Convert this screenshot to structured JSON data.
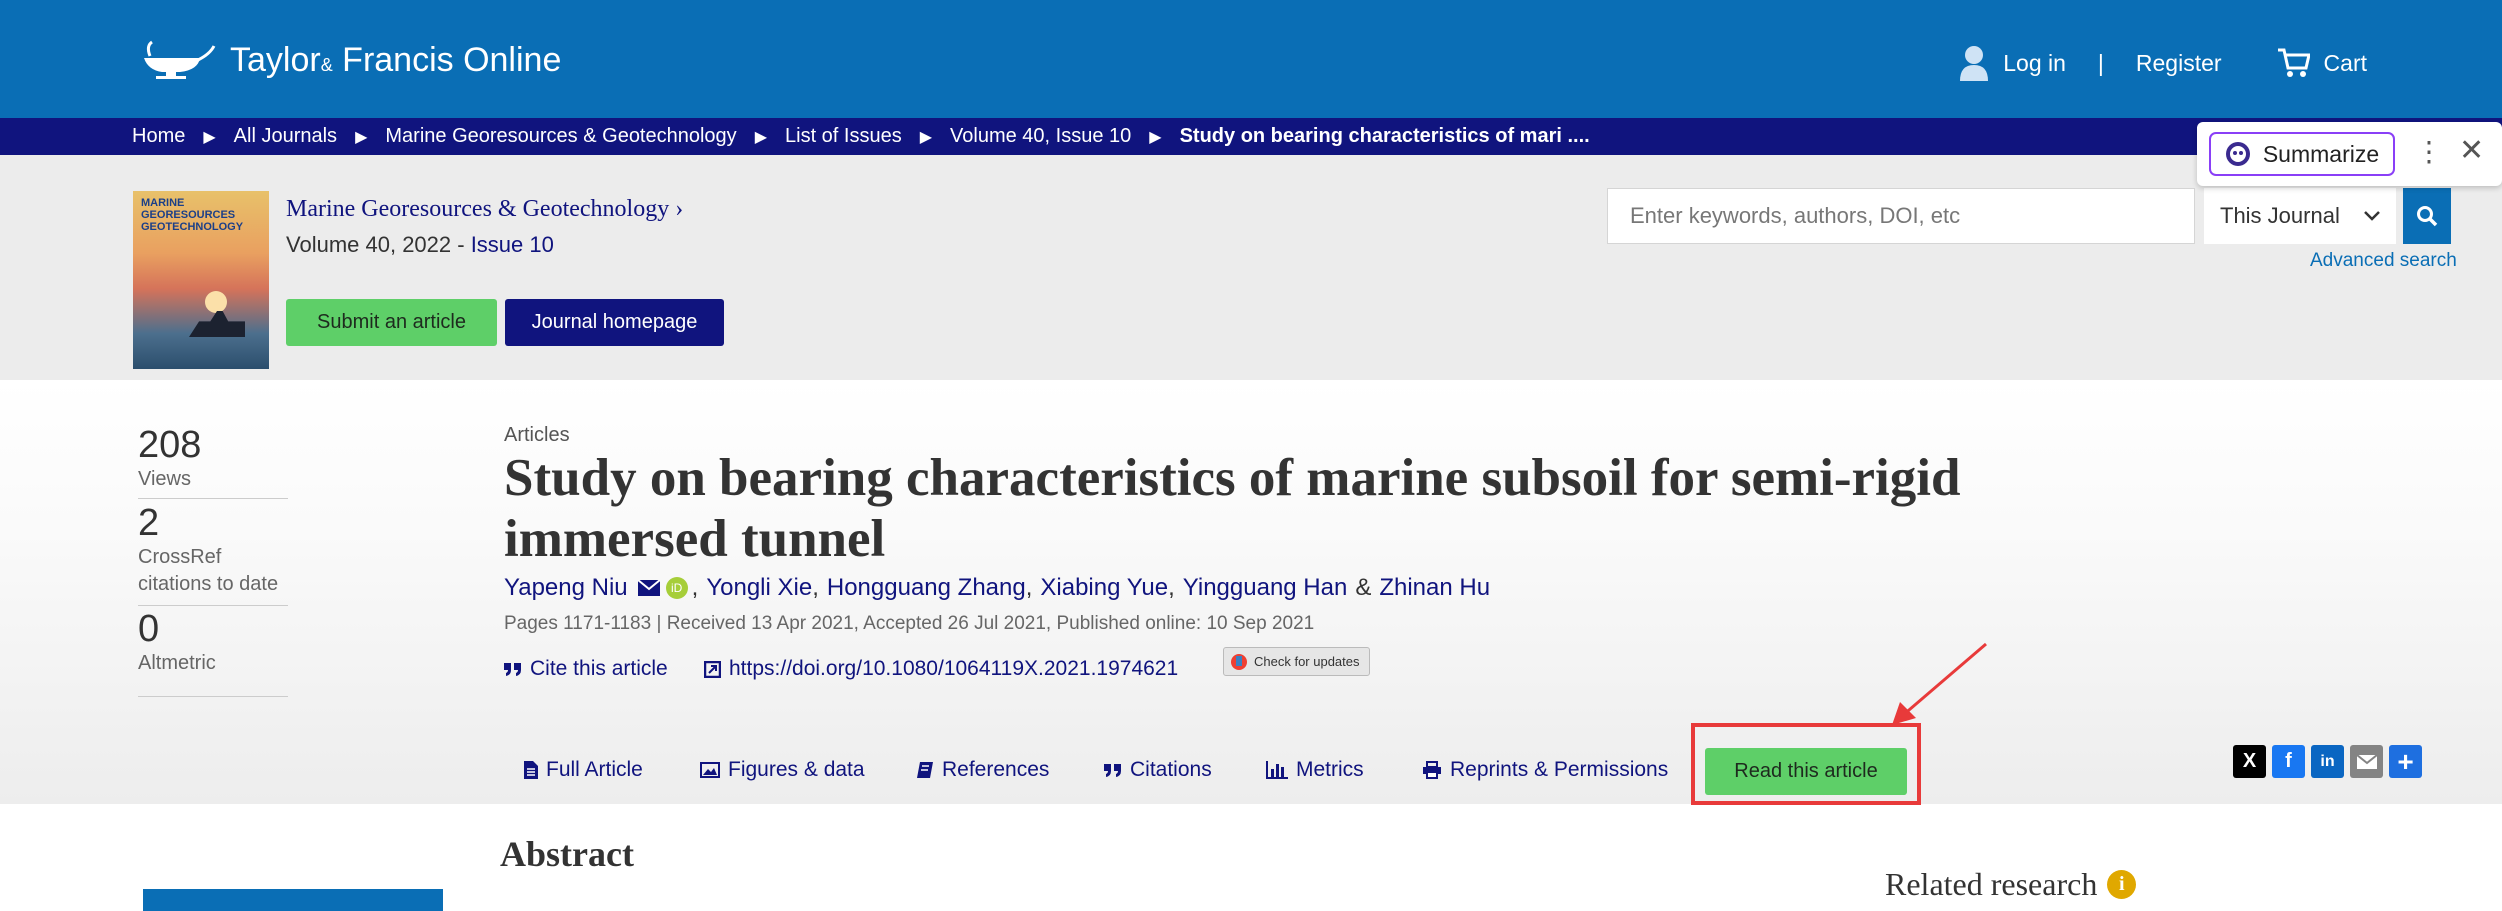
{
  "header": {
    "logo_main": "Taylor",
    "logo_amp": "&",
    "logo_rest": "Francis Online",
    "login": "Log in",
    "separator": "|",
    "register": "Register",
    "cart": "Cart"
  },
  "breadcrumb": {
    "items": [
      "Home",
      "All Journals",
      "Marine Georesources & Geotechnology",
      "List of Issues",
      "Volume 40, Issue 10"
    ],
    "current": "Study on bearing characteristics of mari ....",
    "arrow": "▶"
  },
  "journal": {
    "cover_text": "MARINE GEORESOURCES GEOTECHNOLOGY",
    "title": "Marine Georesources & Geotechnology",
    "title_chevron": "›",
    "volume_prefix": "Volume 40, 2022 - ",
    "issue": "Issue 10",
    "submit_label": "Submit an article",
    "homepage_label": "Journal homepage"
  },
  "search": {
    "placeholder": "Enter keywords, authors, DOI, etc",
    "scope": "This Journal",
    "advanced": "Advanced search"
  },
  "summarize": {
    "label": "Summarize",
    "more": "⋮",
    "close": "✕"
  },
  "metrics": [
    {
      "value": "208",
      "label": "Views"
    },
    {
      "value": "2",
      "label": "CrossRef citations to date"
    },
    {
      "value": "0",
      "label": "Altmetric"
    }
  ],
  "article": {
    "type": "Articles",
    "title": "Study on bearing characteristics of marine subsoil for semi-rigid immersed tunnel",
    "authors": [
      "Yapeng Niu",
      "Yongli Xie",
      "Hongguang Zhang",
      "Xiabing Yue",
      "Yingguang Han",
      "Zhinan Hu"
    ],
    "amp": "&",
    "comma": ",",
    "pub_info": "Pages 1171-1183 | Received 13 Apr 2021, Accepted 26 Jul 2021, Published online: 10 Sep 2021",
    "cite_label": "Cite this article",
    "doi": "https://doi.org/10.1080/1064119X.2021.1974621",
    "check_updates": "Check for updates"
  },
  "tabs": [
    "Full Article",
    "Figures & data",
    "References",
    "Citations",
    "Metrics",
    "Reprints & Permissions"
  ],
  "read_button": "Read this article",
  "share_icons": [
    "x-icon",
    "facebook-icon",
    "linkedin-icon",
    "email-icon",
    "add-icon"
  ],
  "share_colors": {
    "x": "#000000",
    "facebook": "#1877f2",
    "linkedin": "#0a66c2",
    "email": "#848484",
    "add": "#1e6fe0"
  },
  "lower": {
    "abstract_heading": "Abstract",
    "related_heading": "Related research",
    "info_glyph": "i"
  },
  "colors": {
    "header_blue": "#0a6eb5",
    "navy": "#10147e",
    "green": "#5ecf68",
    "highlight_red": "#e83a3a",
    "summarize_purple": "#8a3ff7"
  }
}
